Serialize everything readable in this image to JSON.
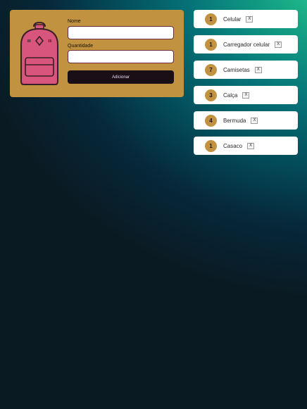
{
  "form": {
    "name_label": "Nome",
    "name_value": "",
    "quantity_label": "Quantidade",
    "quantity_value": "",
    "add_label": "Adicionar"
  },
  "items": [
    {
      "quantity": "1",
      "name": "Celular",
      "remove_label": "X"
    },
    {
      "quantity": "1",
      "name": "Carregador celular",
      "remove_label": "X"
    },
    {
      "quantity": "7",
      "name": "Camisetas",
      "remove_label": "X"
    },
    {
      "quantity": "3",
      "name": "Calça",
      "remove_label": "X"
    },
    {
      "quantity": "4",
      "name": "Bermuda",
      "remove_label": "X"
    },
    {
      "quantity": "1",
      "name": "Casaco",
      "remove_label": "X"
    }
  ],
  "icons": {
    "backpack": "backpack-icon"
  },
  "colors": {
    "card": "#c1923f",
    "badge": "#c1923f",
    "button": "#1a0e17",
    "backpack": "#d8567e",
    "input_border": "#6b2b3d"
  }
}
